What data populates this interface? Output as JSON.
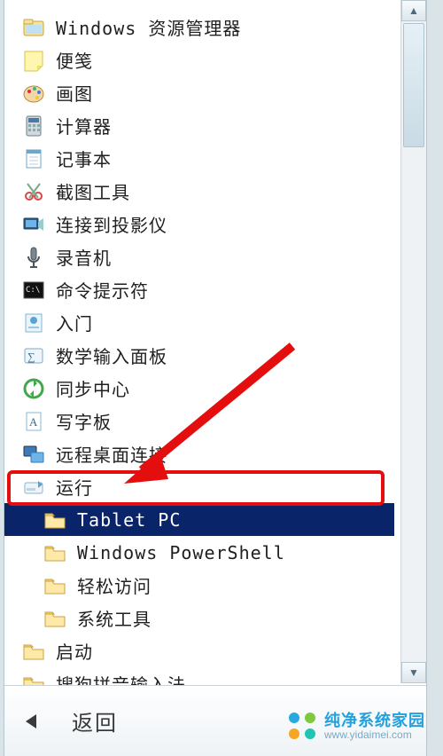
{
  "colors": {
    "selection_bg": "#0a246a",
    "highlight_border": "#e40e0e"
  },
  "items": [
    {
      "id": "explorer",
      "label": "Windows 资源管理器",
      "icon": "explorer-icon",
      "indent": false,
      "selected": false
    },
    {
      "id": "sticky",
      "label": "便笺",
      "icon": "sticky-note-icon",
      "indent": false,
      "selected": false
    },
    {
      "id": "paint",
      "label": "画图",
      "icon": "paint-icon",
      "indent": false,
      "selected": false
    },
    {
      "id": "calculator",
      "label": "计算器",
      "icon": "calculator-icon",
      "indent": false,
      "selected": false
    },
    {
      "id": "notepad",
      "label": "记事本",
      "icon": "notepad-icon",
      "indent": false,
      "selected": false
    },
    {
      "id": "snipping",
      "label": "截图工具",
      "icon": "snipping-icon",
      "indent": false,
      "selected": false
    },
    {
      "id": "projector",
      "label": "连接到投影仪",
      "icon": "projector-icon",
      "indent": false,
      "selected": false
    },
    {
      "id": "recorder",
      "label": "录音机",
      "icon": "recorder-icon",
      "indent": false,
      "selected": false
    },
    {
      "id": "cmd",
      "label": "命令提示符",
      "icon": "cmd-icon",
      "indent": false,
      "selected": false
    },
    {
      "id": "getting",
      "label": "入门",
      "icon": "getting-started-icon",
      "indent": false,
      "selected": false
    },
    {
      "id": "mathinput",
      "label": "数学输入面板",
      "icon": "math-input-icon",
      "indent": false,
      "selected": false
    },
    {
      "id": "sync",
      "label": "同步中心",
      "icon": "sync-center-icon",
      "indent": false,
      "selected": false
    },
    {
      "id": "wordpad",
      "label": "写字板",
      "icon": "wordpad-icon",
      "indent": false,
      "selected": false
    },
    {
      "id": "rdp",
      "label": "远程桌面连接",
      "icon": "remote-desktop-icon",
      "indent": false,
      "selected": false
    },
    {
      "id": "run",
      "label": "运行",
      "icon": "run-icon",
      "indent": false,
      "selected": false
    },
    {
      "id": "tabletpc",
      "label": "Tablet PC",
      "icon": "folder-icon",
      "indent": true,
      "selected": true
    },
    {
      "id": "powershell",
      "label": "Windows PowerShell",
      "icon": "folder-icon",
      "indent": true,
      "selected": false
    },
    {
      "id": "ease",
      "label": "轻松访问",
      "icon": "folder-icon",
      "indent": true,
      "selected": false
    },
    {
      "id": "systools",
      "label": "系统工具",
      "icon": "folder-icon",
      "indent": true,
      "selected": false
    }
  ],
  "extra_items": [
    {
      "id": "startup",
      "label": "启动",
      "icon": "folder-icon"
    },
    {
      "id": "sogou",
      "label": "搜狗拼音输入法",
      "icon": "folder-icon"
    }
  ],
  "back_label": "返回",
  "watermark": {
    "title": "纯净系统家园",
    "url": "www.yidaimei.com"
  }
}
